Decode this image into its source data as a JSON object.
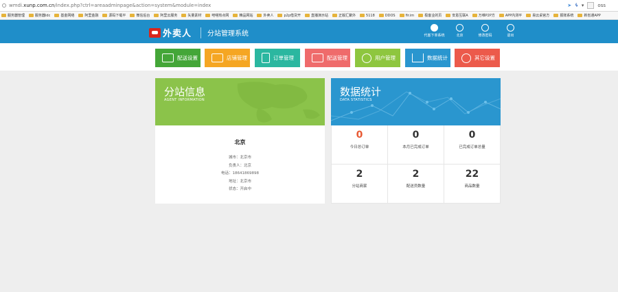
{
  "browser": {
    "url_prefix": "wmdi.",
    "url_domain": "xunp.com.cn",
    "url_path": "/index.php?ctrl=areaadminpage&action=system&module=index",
    "search_text": "oss"
  },
  "bookmarks": [
    "服务器管理",
    "服务器idc",
    "基金网络",
    "阿里金融",
    "源码下载平",
    "微信后台",
    "阿里云服务",
    "矢量素材",
    "吧嗒热点网",
    "精品网站",
    "外卖人",
    "p2p借贷开",
    "直播演示站",
    "正版汇聚外",
    "5118",
    "DDOS",
    "fir.im",
    "极客业的页",
    "安恳互联A",
    "万维P2P方",
    "APP内测平",
    "易云桌官方",
    "报账系统",
    "新省通APP"
  ],
  "header": {
    "logo_text": "外卖人",
    "system_title": "分站管理系统",
    "icons": [
      {
        "icon": "user-order-icon",
        "label": "代客下单系统"
      },
      {
        "icon": "user-icon",
        "label": "北京"
      },
      {
        "icon": "settings-icon",
        "label": "修改密码"
      },
      {
        "icon": "power-icon",
        "label": "退出"
      }
    ]
  },
  "nav": [
    {
      "label": "配送设置",
      "color": "#44a638",
      "icon": "shop-icon"
    },
    {
      "label": "店铺管理",
      "color": "#f5a623",
      "icon": "store-icon"
    },
    {
      "label": "订单管理",
      "color": "#2bb7a0",
      "icon": "clipboard-icon"
    },
    {
      "label": "配送管理",
      "color": "#ef6b6b",
      "icon": "delivery-icon"
    },
    {
      "label": "用户管理",
      "color": "#8ec63f",
      "icon": "user-icon"
    },
    {
      "label": "数据统计",
      "color": "#2a96cf",
      "icon": "bar-chart-icon"
    },
    {
      "label": "其它设置",
      "color": "#ec5a4b",
      "icon": "plus-icon"
    }
  ],
  "agent": {
    "title": "分站信息",
    "subtitle": "AGENT INFORMATION",
    "city": "北京",
    "lines": [
      "城市：北京市",
      "负责人：北京",
      "电话：18641869898",
      "地址：北京市",
      "状态：开启中"
    ]
  },
  "stats": {
    "title": "数据统计",
    "subtitle": "DATA STATISTICS",
    "cells": [
      {
        "value": "0",
        "label": "今日总订单"
      },
      {
        "value": "0",
        "label": "本月已完成订单"
      },
      {
        "value": "0",
        "label": "已完成订单总量"
      },
      {
        "value": "2",
        "label": "分站商家"
      },
      {
        "value": "2",
        "label": "配送员数量"
      },
      {
        "value": "22",
        "label": "商品数量"
      }
    ]
  }
}
